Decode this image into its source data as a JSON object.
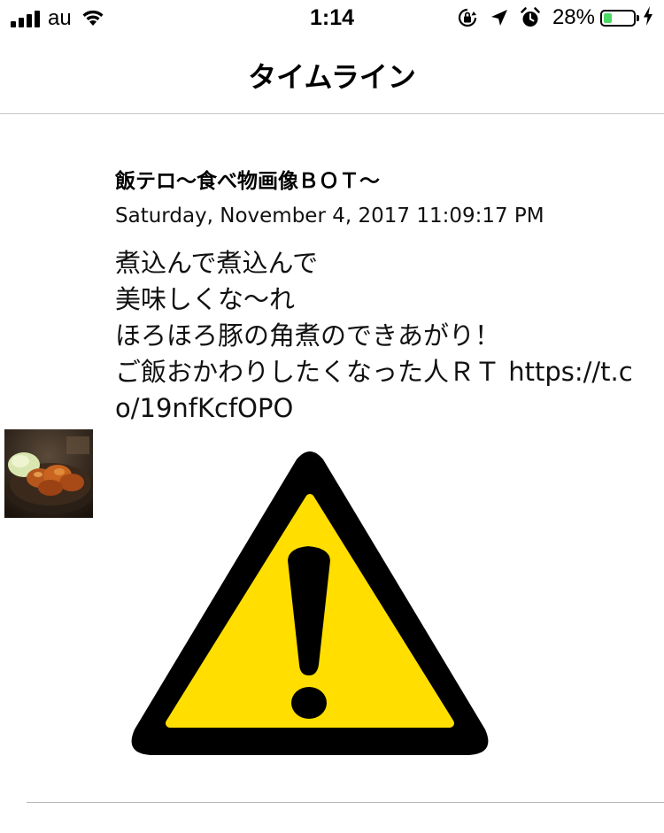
{
  "status_bar": {
    "carrier": "au",
    "time": "1:14",
    "battery_percent": "28%",
    "battery_level": 0.28,
    "icons": [
      "signal-icon",
      "wifi-icon",
      "orientation-lock-icon",
      "location-icon",
      "alarm-icon",
      "battery-icon",
      "charging-icon"
    ]
  },
  "nav": {
    "title": "タイムライン"
  },
  "tweet": {
    "user_name": "飯テロ〜食べ物画像ＢＯＴ〜",
    "date": "Saturday, November 4, 2017 11:09:17 PM",
    "text": "煮込んで煮込んで\n美味しくな〜れ\nほろほろ豚の角煮のできあがり！\nご飯おかわりしたくなった人ＲＴ https://t.co/19nfKcfOPO",
    "avatar_icon": "food-avatar-image",
    "media_icon": "warning-triangle-icon",
    "colors": {
      "warning_yellow": "#ffde00",
      "warning_black": "#000000"
    }
  }
}
